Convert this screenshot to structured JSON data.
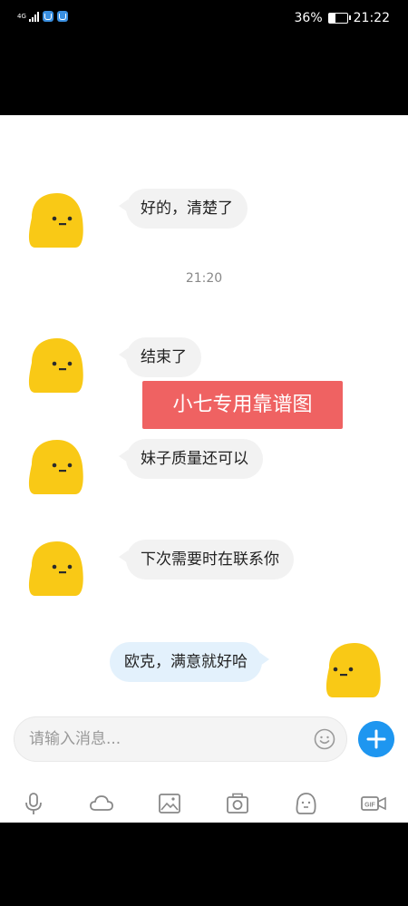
{
  "status_bar": {
    "network": "4G",
    "battery_percent": "36%",
    "battery_level": 0.36,
    "time": "21:22",
    "icons": [
      "signal-icon",
      "app-notification-icon",
      "app-notification-icon"
    ]
  },
  "messages": [
    {
      "side": "left",
      "text": "好的，清楚了"
    },
    {
      "side": "left",
      "text": "结束了"
    },
    {
      "side": "left",
      "text": "妹子质量还可以"
    },
    {
      "side": "left",
      "text": "下次需要时在联系你"
    },
    {
      "side": "right",
      "text": "欧克，满意就好哈"
    }
  ],
  "timestamp": "21:20",
  "watermark": "小七专用靠谱图",
  "input": {
    "placeholder": "请输入消息..."
  },
  "toolbar_icons": [
    "microphone-icon",
    "cloud-icon",
    "image-icon",
    "camera-icon",
    "emoji-icon",
    "gif-icon"
  ],
  "colors": {
    "accent": "#1e96f0",
    "avatar": "#f9c916",
    "watermark_bg": "#ef6262",
    "outgoing_bubble": "#e3f1fc"
  }
}
